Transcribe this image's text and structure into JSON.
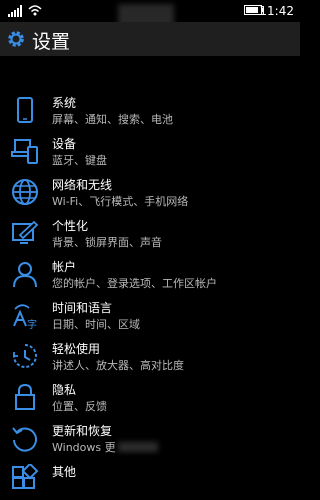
{
  "status": {
    "time": "11:42",
    "icons": [
      "signal-icon",
      "wifi-icon",
      "battery-icon"
    ]
  },
  "header": {
    "title": "设置",
    "icon": "gear-icon"
  },
  "accent": "#3a8ee6",
  "settings": [
    {
      "label": "系统",
      "desc": "屏幕、通知、搜索、电池",
      "icon": "phone-icon"
    },
    {
      "label": "设备",
      "desc": "蓝牙、键盘",
      "icon": "devices-icon"
    },
    {
      "label": "网络和无线",
      "desc": "Wi-Fi、飞行模式、手机网络",
      "icon": "globe-icon"
    },
    {
      "label": "个性化",
      "desc": "背景、锁屏界面、声音",
      "icon": "personalize-icon"
    },
    {
      "label": "帐户",
      "desc": "您的帐户、登录选项、工作区帐户",
      "icon": "person-icon"
    },
    {
      "label": "时间和语言",
      "desc": "日期、时间、区域",
      "icon": "time-language-icon"
    },
    {
      "label": "轻松使用",
      "desc": "讲述人、放大器、高对比度",
      "icon": "ease-of-access-icon"
    },
    {
      "label": "隐私",
      "desc": "位置、反馈",
      "icon": "lock-icon"
    },
    {
      "label": "更新和恢复",
      "desc": "Windows 更",
      "icon": "update-icon"
    },
    {
      "label": "其他",
      "desc": "",
      "icon": "extras-icon"
    }
  ]
}
